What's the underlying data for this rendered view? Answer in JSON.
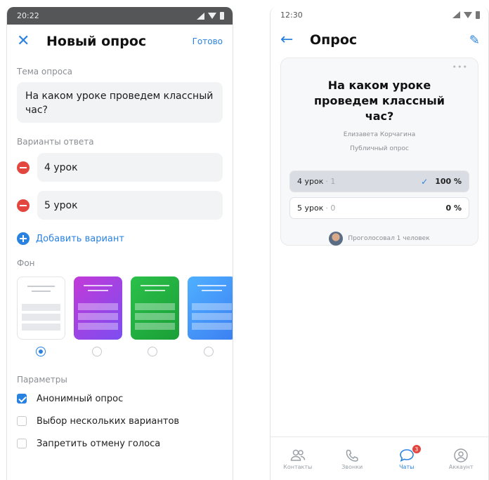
{
  "left": {
    "status_time": "20:22",
    "header": {
      "title": "Новый опрос",
      "done": "Готово"
    },
    "topic_label": "Тема опроса",
    "topic_value": "На каком уроке проведем классный час?",
    "answers_label": "Варианты ответа",
    "answers": [
      "4 урок",
      "5 урок"
    ],
    "add_option": "Добавить вариант",
    "background_label": "Фон",
    "backgrounds": [
      "white",
      "pink",
      "green",
      "blue"
    ],
    "selected_background": 0,
    "params_label": "Параметры",
    "params": [
      {
        "label": "Анонимный опрос",
        "checked": true
      },
      {
        "label": "Выбор нескольких вариантов",
        "checked": false
      },
      {
        "label": "Запретить отмену голоса",
        "checked": false
      }
    ]
  },
  "right": {
    "status_time": "12:30",
    "header": {
      "title": "Опрос"
    },
    "poll": {
      "question": "На каком уроке проведем классный час?",
      "author": "Елизавета Корчагина",
      "type": "Публичный опрос",
      "options": [
        {
          "label": "4 урок",
          "count": "· 1",
          "percent": "100 %",
          "fill": 1.0,
          "voted": true
        },
        {
          "label": "5 урок",
          "count": "· 0",
          "percent": "0 %",
          "fill": 0.0,
          "voted": false
        }
      ],
      "voters": "Проголосовал 1 человек"
    },
    "tabs": [
      {
        "label": "Контакты",
        "icon": "contacts-icon"
      },
      {
        "label": "Звонки",
        "icon": "phone-icon"
      },
      {
        "label": "Чаты",
        "icon": "chat-icon",
        "badge": "3",
        "active": true
      },
      {
        "label": "Аккаунт",
        "icon": "account-icon"
      }
    ]
  },
  "colors": {
    "accent": "#2a82e0",
    "danger": "#e3463f"
  }
}
